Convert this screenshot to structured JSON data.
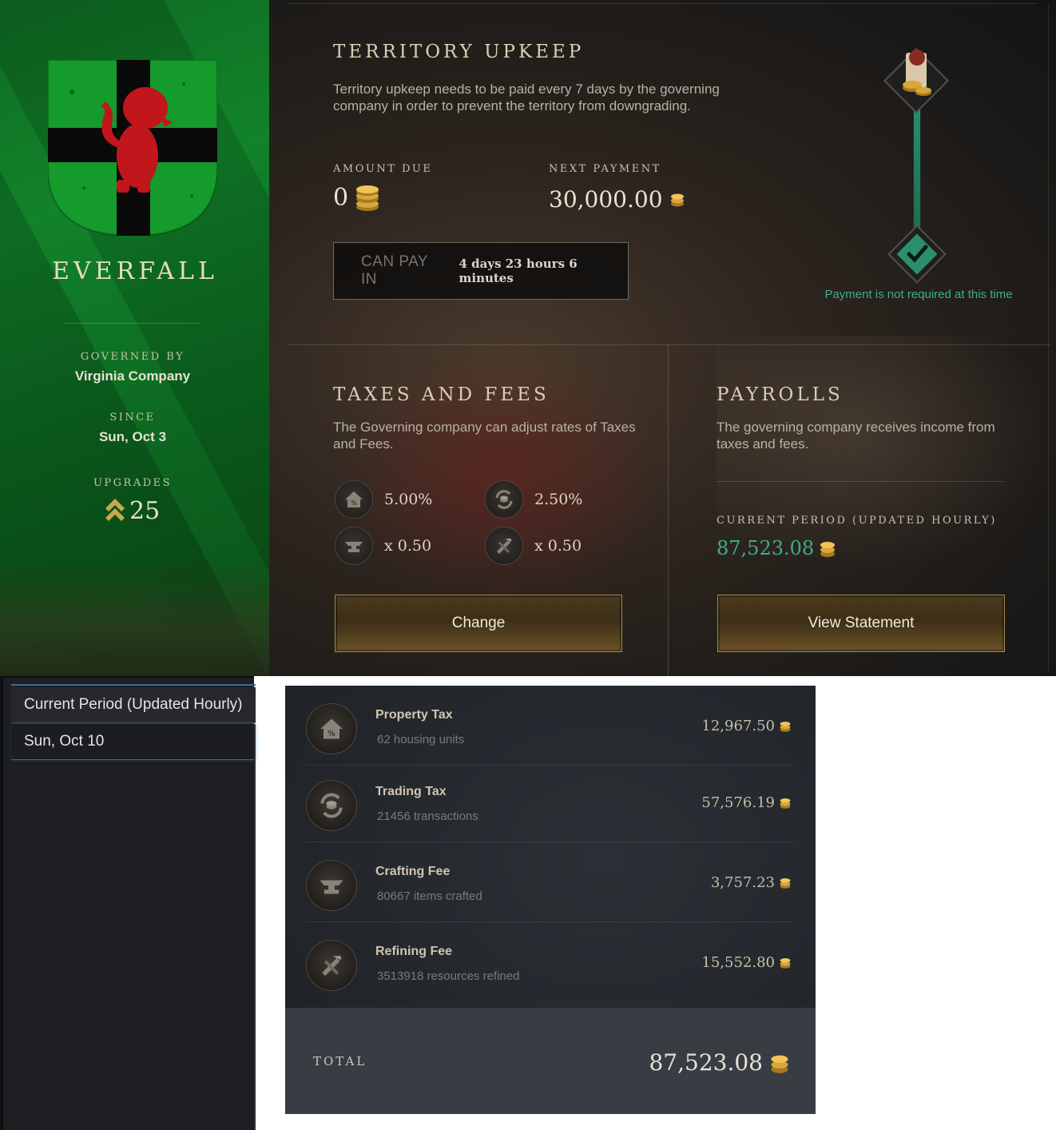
{
  "territory": {
    "name": "EVERFALL",
    "governed_by_label": "GOVERNED BY",
    "governed_by": "Virginia Company",
    "since_label": "SINCE",
    "since": "Sun, Oct 3",
    "upgrades_label": "UPGRADES",
    "upgrades": "25",
    "banner_color": "#12832a",
    "crest_colors": {
      "field": "#149b2c",
      "cross": "#0a0a0a",
      "lion": "#c0161c"
    }
  },
  "upkeep": {
    "title": "TERRITORY UPKEEP",
    "description": "Territory upkeep needs to be paid every 7 days by the governing company in order to prevent the territory from downgrading.",
    "amount_due_label": "AMOUNT DUE",
    "amount_due": "0",
    "next_payment_label": "NEXT PAYMENT",
    "next_payment": "30,000.00",
    "can_pay_label": "CAN PAY IN",
    "can_pay_value": "4 days 23 hours 6 minutes",
    "status_note": "Payment is not required at this time",
    "progress_fraction": 1.0,
    "accent_color": "#3fae86"
  },
  "taxes": {
    "title": "TAXES AND FEES",
    "description": "The Governing company can adjust rates of Taxes and Fees.",
    "rates": [
      {
        "icon": "property-tax-icon",
        "value": "5.00%"
      },
      {
        "icon": "trading-tax-icon",
        "value": "2.50%"
      },
      {
        "icon": "crafting-fee-icon",
        "value": "x 0.50"
      },
      {
        "icon": "refining-fee-icon",
        "value": "x 0.50"
      }
    ],
    "change_label": "Change"
  },
  "payrolls": {
    "title": "PAYROLLS",
    "description": "The governing company receives income from taxes and fees.",
    "period_label": "CURRENT PERIOD (UPDATED HOURLY)",
    "period_amount": "87,523.08",
    "view_label": "View Statement",
    "amount_color": "#3fae86"
  },
  "statement": {
    "periods": [
      {
        "label": "Current Period (Updated Hourly)"
      },
      {
        "label": "Sun, Oct 10"
      }
    ],
    "items": [
      {
        "icon": "property-tax-icon",
        "name": "Property Tax",
        "detail": "62 housing units",
        "amount": "12,967.50"
      },
      {
        "icon": "trading-tax-icon",
        "name": "Trading Tax",
        "detail": "21456 transactions",
        "amount": "57,576.19"
      },
      {
        "icon": "crafting-fee-icon",
        "name": "Crafting Fee",
        "detail": "80667 items crafted",
        "amount": "3,757.23"
      },
      {
        "icon": "refining-fee-icon",
        "name": "Refining Fee",
        "detail": "3513918 resources refined",
        "amount": "15,552.80"
      }
    ],
    "total_label": "TOTAL",
    "total": "87,523.08"
  }
}
